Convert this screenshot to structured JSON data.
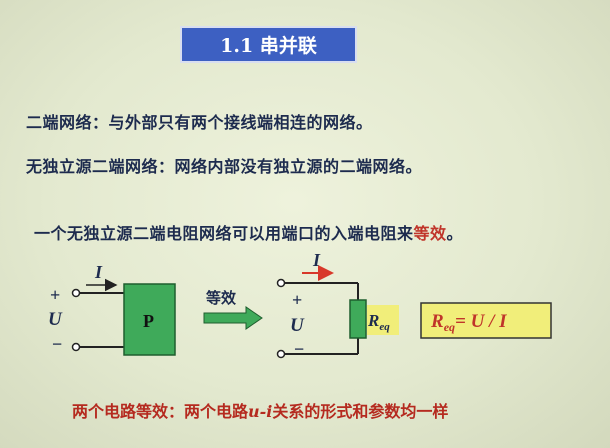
{
  "slide": {
    "title": "1.1 串并联",
    "definitions": [
      "二端网络：与外部只有两个接线端相连的网络。",
      "无独立源二端网络：网络内部没有独立源的二端网络。"
    ],
    "statement_main": "一个无独立源二端电阻网络可以用端口的入端电阻来",
    "statement_highlight": "等效",
    "statement_end": "。",
    "conclusion_prefix": "两个电路等效：两个电路",
    "conclusion_ui": "u-i",
    "conclusion_suffix": "关系的形式和参数均一样"
  },
  "diagram": {
    "left_current": "I",
    "left_plus": "+",
    "left_voltage": "U",
    "left_minus": "−",
    "box_label": "P",
    "equiv_label": "等效",
    "right_current": "I",
    "right_plus": "+",
    "right_voltage": "U",
    "right_minus": "−",
    "resistor_label": "R",
    "resistor_sub": "eq",
    "formula_R": "R",
    "formula_sub": "eq",
    "formula_rest": "= U / I"
  },
  "colors": {
    "title_bg": "#3d60c2",
    "box_green": "#3faa5a",
    "highlight_yellow": "#f1ee7a",
    "arrow_red": "#d8382a",
    "formula_red": "#c0352a"
  }
}
